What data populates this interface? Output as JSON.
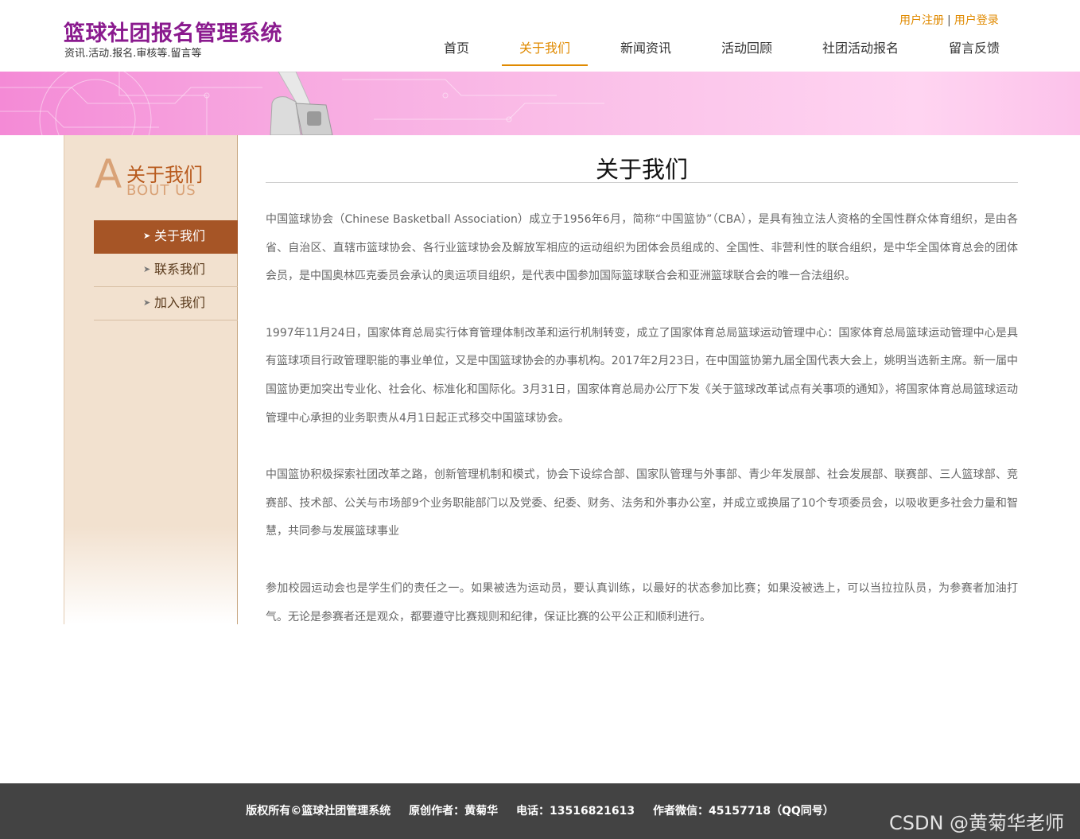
{
  "header": {
    "site_title": "篮球社团报名管理系统",
    "site_subtitle": "资讯.活动.报名.审核等.留言等",
    "register_link": "用户注册",
    "separator": "|",
    "login_link": "用户登录"
  },
  "nav": {
    "items": [
      {
        "label": "首页"
      },
      {
        "label": "关于我们"
      },
      {
        "label": "新闻资讯"
      },
      {
        "label": "活动回顾"
      },
      {
        "label": "社团活动报名"
      },
      {
        "label": "留言反馈"
      }
    ],
    "active_index": 1,
    "accent_color": "#e08a00"
  },
  "sidebar": {
    "about_letter": "A",
    "about_cn": "关于我们",
    "about_en": "BOUT US",
    "items": [
      {
        "label": "关于我们",
        "icon": "chevron-right-icon"
      },
      {
        "label": "联系我们",
        "icon": "chevron-right-icon"
      },
      {
        "label": "加入我们",
        "icon": "chevron-right-icon"
      }
    ],
    "active_index": 0,
    "active_color": "#a65526"
  },
  "content": {
    "title": "关于我们",
    "paragraphs": [
      "中国篮球协会（Chinese Basketball Association）成立于1956年6月，简称“中国篮协”（CBA），是具有独立法人资格的全国性群众体育组织，是由各省、自治区、直辖市篮球协会、各行业篮球协会及解放军相应的运动组织为团体会员组成的、全国性、非营利性的联合组织，是中华全国体育总会的团体会员，是中国奥林匹克委员会承认的奥运项目组织，是代表中国参加国际篮球联合会和亚洲篮球联合会的唯一合法组织。",
      "1997年11月24日，国家体育总局实行体育管理体制改革和运行机制转变，成立了国家体育总局篮球运动管理中心：国家体育总局篮球运动管理中心是具有篮球项目行政管理职能的事业单位，又是中国篮球协会的办事机构。2017年2月23日，在中国篮协第九届全国代表大会上，姚明当选新主席。新一届中国篮协更加突出专业化、社会化、标准化和国际化。3月31日，国家体育总局办公厅下发《关于篮球改革试点有关事项的通知》，将国家体育总局篮球运动管理中心承担的业务职责从4月1日起正式移交中国篮球协会。",
      "中国篮协积极探索社团改革之路，创新管理机制和模式，协会下设综合部、国家队管理与外事部、青少年发展部、社会发展部、联赛部、三人篮球部、竞赛部、技术部、公关与市场部9个业务职能部门以及党委、纪委、财务、法务和外事办公室，并成立或换届了10个专项委员会，以吸收更多社会力量和智慧，共同参与发展篮球事业",
      "参加校园运动会也是学生们的责任之一。如果被选为运动员，要认真训练，以最好的状态参加比赛；如果没被选上，可以当拉拉队员，为参赛者加油打气。无论是参赛者还是观众，都要遵守比赛规则和纪律，保证比赛的公平公正和顺利进行。"
    ]
  },
  "footer": {
    "copyright": "版权所有©篮球社团管理系统",
    "author": "原创作者：黄菊华",
    "phone": "电话：13516821613",
    "wechat": "作者微信：45157718（QQ同号）"
  },
  "watermark": "CSDN @黄菊华老师"
}
